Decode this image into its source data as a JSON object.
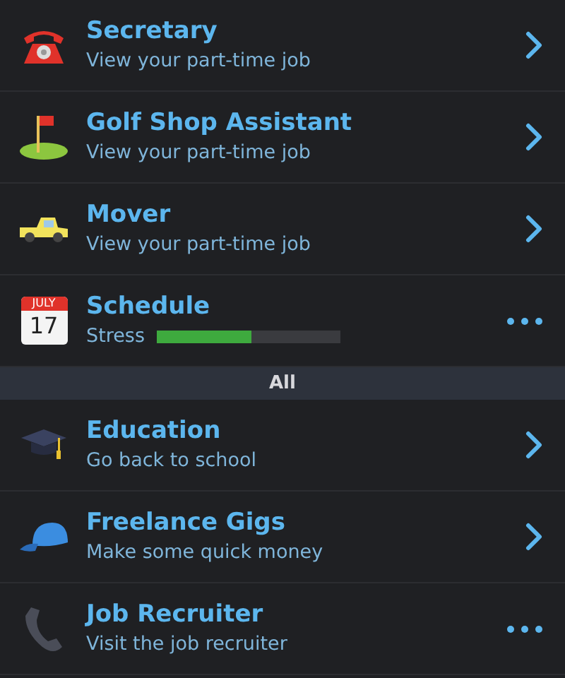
{
  "sections": [
    {
      "rows": [
        {
          "title": "Secretary",
          "subtitle": "View your part-time job",
          "kind": "chevron"
        },
        {
          "title": "Golf Shop Assistant",
          "subtitle": "View your part-time job",
          "kind": "chevron"
        },
        {
          "title": "Mover",
          "subtitle": "View your part-time job",
          "kind": "chevron"
        },
        {
          "calendar": {
            "month": "JULY",
            "day": "17"
          },
          "title": "Schedule",
          "meter": {
            "label": "Stress",
            "level": 0.52
          },
          "kind": "more"
        }
      ]
    },
    {
      "header": "All",
      "rows": [
        {
          "title": "Education",
          "subtitle": "Go back to school",
          "kind": "chevron"
        },
        {
          "title": "Freelance Gigs",
          "subtitle": "Make some quick money",
          "kind": "chevron"
        },
        {
          "title": "Job Recruiter",
          "subtitle": "Visit the job recruiter",
          "kind": "more"
        }
      ]
    }
  ]
}
